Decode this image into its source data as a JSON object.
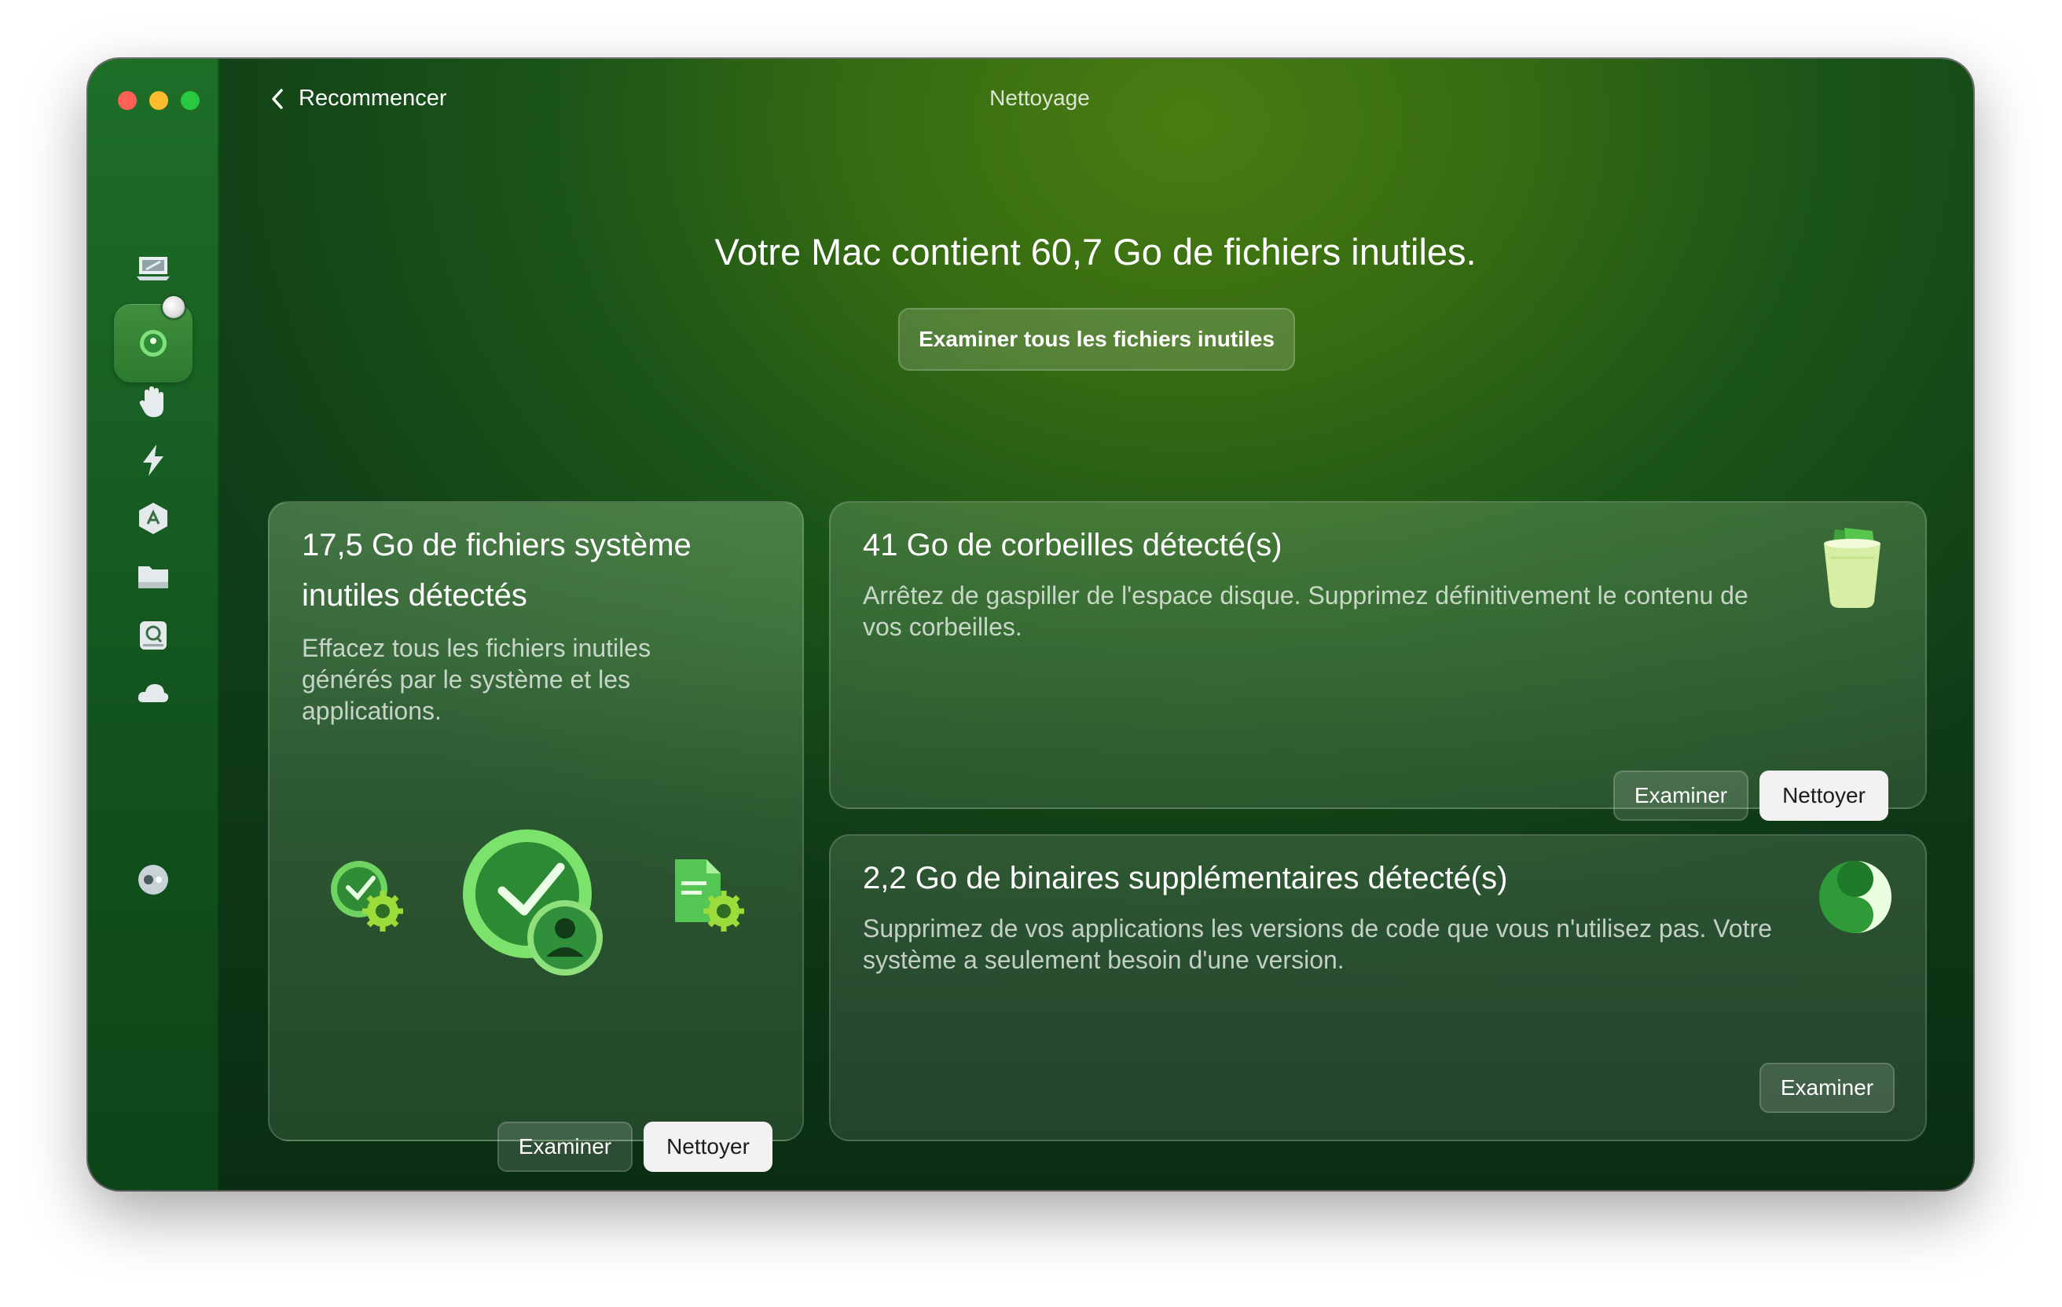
{
  "window": {
    "title": "Nettoyage",
    "back_label": "Recommencer"
  },
  "sidebar": {
    "items": [
      {
        "icon": "monitor-scan-icon"
      },
      {
        "icon": "cleanup-icon",
        "active": true
      },
      {
        "icon": "hand-protection-icon"
      },
      {
        "icon": "lightning-icon"
      },
      {
        "icon": "applications-icon"
      },
      {
        "icon": "folder-icon"
      },
      {
        "icon": "disk-search-icon"
      },
      {
        "icon": "cloud-icon"
      }
    ],
    "assistant_icon": "assistant-icon"
  },
  "main": {
    "headline": "Votre Mac contient 60,7 Go de fichiers inutiles.",
    "review_all_label": "Examiner tous les fichiers inutiles"
  },
  "cards": [
    {
      "title_line1": "17,5 Go de fichiers système",
      "title_line2": "inutiles détectés",
      "desc_line1": "Effacez tous les fichiers inutiles",
      "desc_line2": "générés par le système et les",
      "desc_line3": "applications.",
      "review_label": "Examiner",
      "clean_label": "Nettoyer"
    },
    {
      "title": "41 Go de corbeilles détecté(s)",
      "desc_line1": "Arrêtez de gaspiller de l'espace disque. Supprimez définitivement le contenu de",
      "desc_line2": "vos corbeilles.",
      "review_label": "Examiner",
      "clean_label": "Nettoyer"
    },
    {
      "title": "2,2 Go de binaires supplémentaires détecté(s)",
      "desc_line1": "Supprimez de vos applications les versions de code que vous n'utilisez pas. Votre",
      "desc_line2": "système a seulement besoin d'une version.",
      "review_label": "Examiner"
    }
  ],
  "colors": {
    "accent_green": "#3a8f3e",
    "traffic_red": "#fe5f57",
    "traffic_yellow": "#febc2e",
    "traffic_green": "#28c840"
  }
}
